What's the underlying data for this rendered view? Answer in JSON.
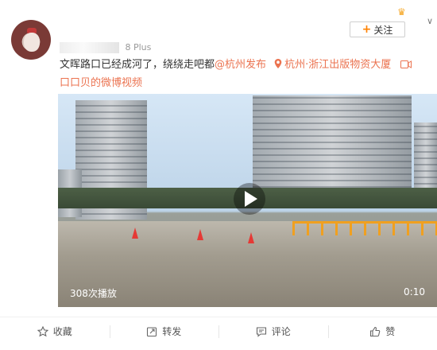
{
  "post": {
    "meta_suffix": "8 Plus",
    "follow_label": "关注",
    "text_main": "文晖路口已经成河了，绕绕走吧都",
    "mention": "@杭州发布",
    "location": "杭州·浙江出版物资大厦",
    "line2": "口口贝的微博视频"
  },
  "video": {
    "plays": "308次播放",
    "duration": "0:10"
  },
  "actions": [
    {
      "label": "收藏",
      "icon": "star-icon"
    },
    {
      "label": "转发",
      "icon": "repost-icon"
    },
    {
      "label": "评论",
      "icon": "comment-icon"
    },
    {
      "label": "赞",
      "icon": "like-icon"
    }
  ],
  "colors": {
    "link": "#eb7350",
    "follow_plus": "#ff8200"
  }
}
